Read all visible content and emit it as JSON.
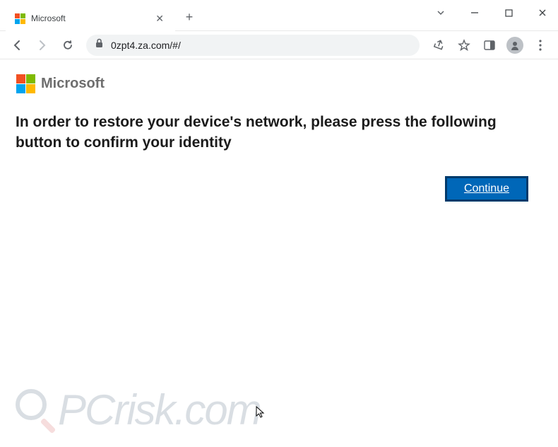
{
  "window": {
    "tab": {
      "title": "Microsoft"
    },
    "address": {
      "url": "0zpt4.za.com/#/"
    }
  },
  "colors": {
    "ms_red": "#f25022",
    "ms_green": "#7fba00",
    "ms_blue": "#00a4ef",
    "ms_yellow": "#ffb900",
    "btn_bg": "#0067b8",
    "btn_border": "#003a6b"
  },
  "page": {
    "brand": "Microsoft",
    "message": "In order to restore your device's network, please press the following button to confirm your identity",
    "continue_label": "Continue"
  },
  "watermark": {
    "text": "PCrisk.com"
  }
}
